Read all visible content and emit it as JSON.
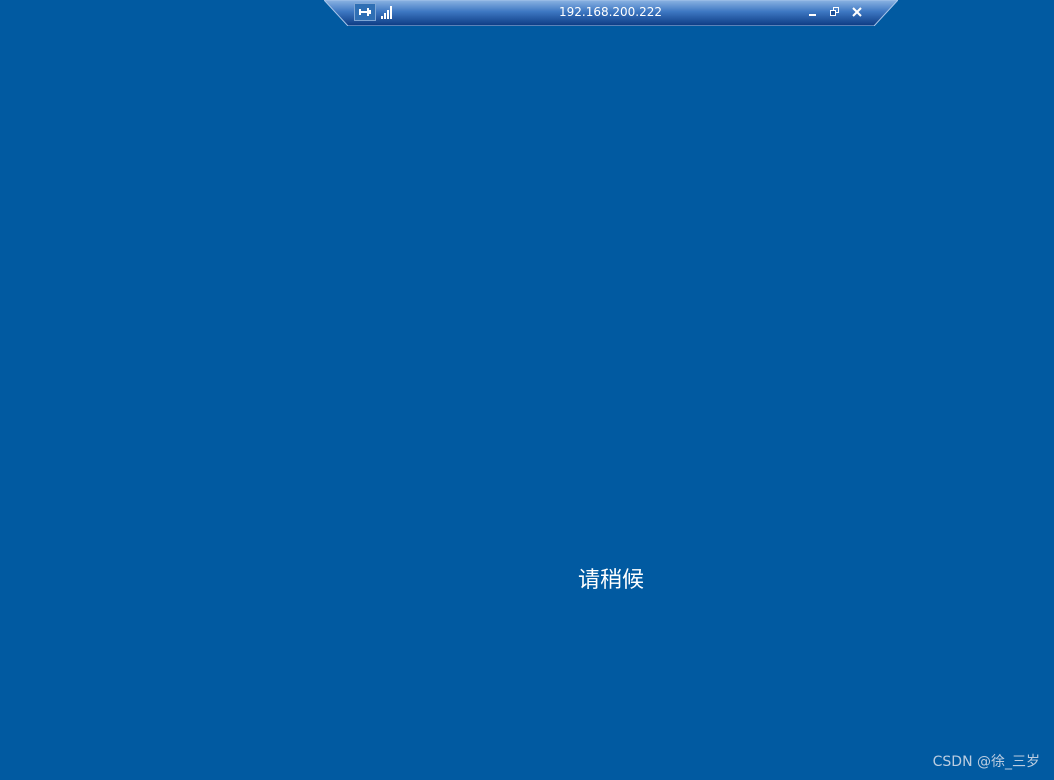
{
  "connection_bar": {
    "host": "192.168.200.222",
    "icons": {
      "pin": "pin-icon",
      "signal": "signal-strength-icon",
      "minimize": "minimize-icon",
      "restore": "restore-icon",
      "close": "close-icon"
    }
  },
  "main": {
    "status_text": "请稍候"
  },
  "watermark": {
    "text": "CSDN @徐_三岁"
  },
  "colors": {
    "background": "#015aa1",
    "bar_top": "#6f9fd6",
    "bar_bottom": "#0d3f87",
    "text": "#ffffff"
  }
}
